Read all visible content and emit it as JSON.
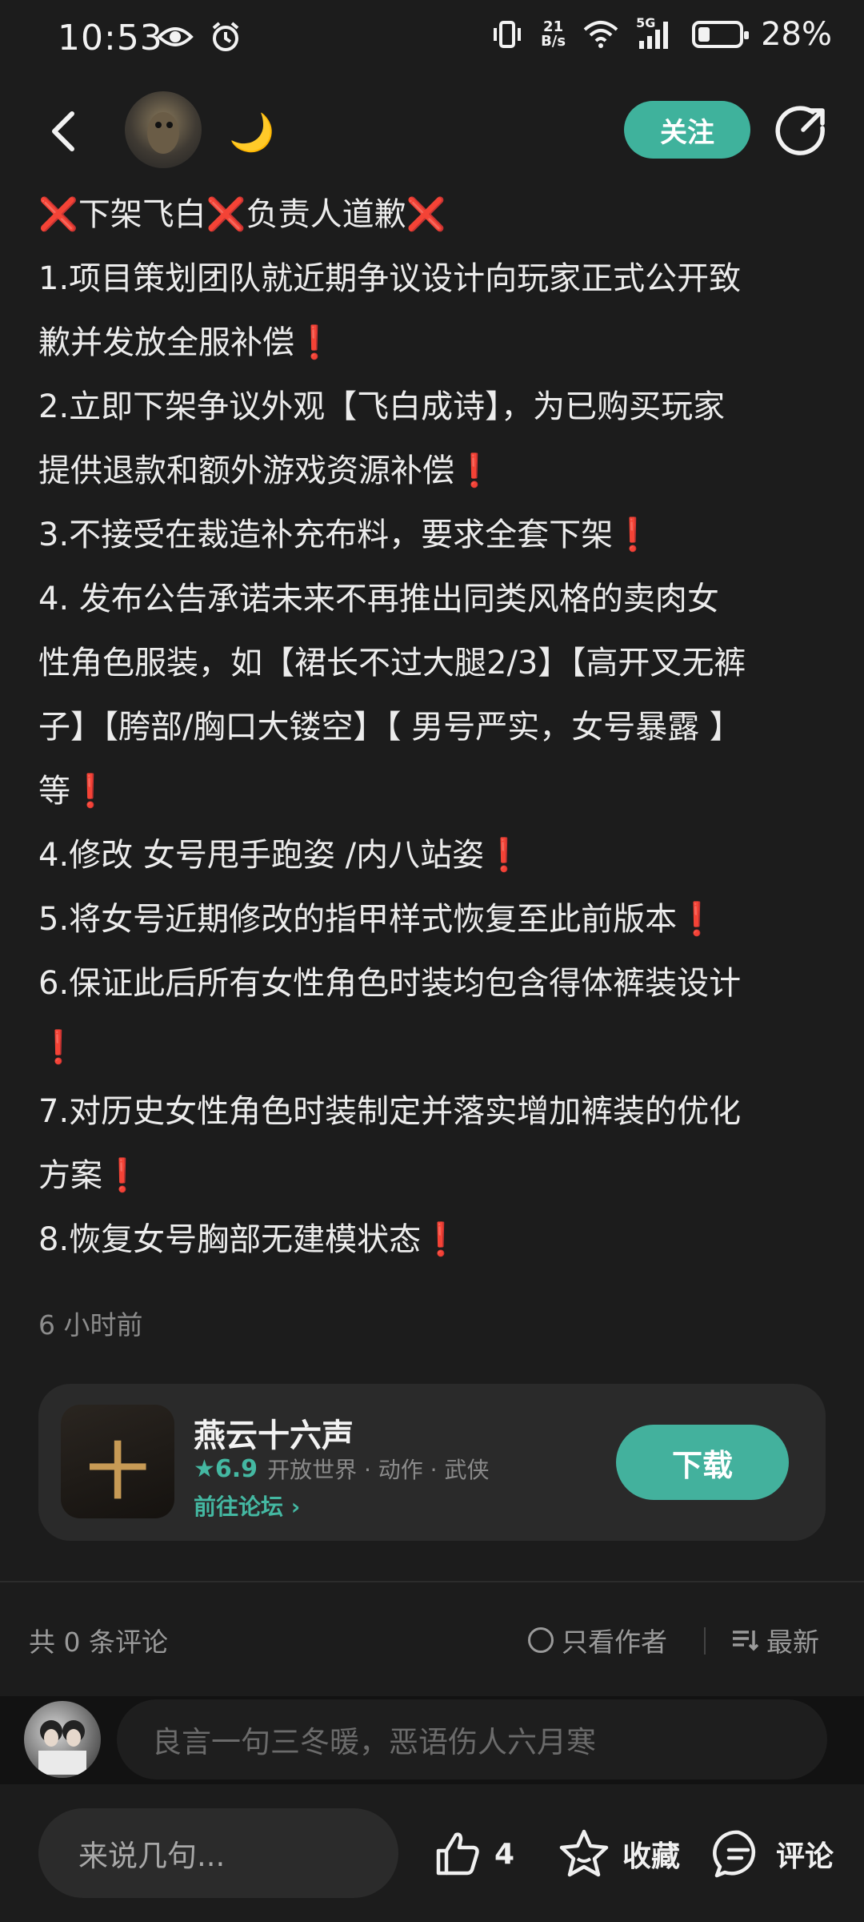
{
  "status_bar": {
    "time": "10:53",
    "net_speed_top": "21",
    "net_speed_bottom": "B/s",
    "signal": "5G",
    "battery": "28%",
    "battery_level": 0.28
  },
  "header": {
    "follow_label": "关注",
    "moon": "🌙"
  },
  "post": {
    "lines": [
      {
        "parts": [
          [
            "x",
            "❌"
          ],
          [
            "t",
            "下架飞白"
          ],
          [
            "x",
            "❌"
          ],
          [
            "t",
            "负责人道歉"
          ],
          [
            "x",
            "❌"
          ]
        ]
      },
      {
        "parts": [
          [
            "t",
            "1.项目策划团队就近期争议设计向玩家正式公开致"
          ]
        ]
      },
      {
        "parts": [
          [
            "t",
            "歉并发放全服补偿"
          ],
          [
            "b",
            "❗"
          ]
        ]
      },
      {
        "parts": [
          [
            "t",
            "2.立即下架争议外观【飞白成诗】，为已购买玩家"
          ]
        ]
      },
      {
        "parts": [
          [
            "t",
            "提供退款和额外游戏资源补偿"
          ],
          [
            "b",
            "❗"
          ]
        ]
      },
      {
        "parts": [
          [
            "t",
            "3.不接受在裁造补充布料，要求全套下架"
          ],
          [
            "b",
            "❗"
          ]
        ]
      },
      {
        "parts": [
          [
            "t",
            "4. 发布公告承诺未来不再推出同类风格的卖肉女"
          ]
        ]
      },
      {
        "parts": [
          [
            "t",
            "性角色服装，如【裙长不过大腿2/3】【高开叉无裤"
          ]
        ]
      },
      {
        "parts": [
          [
            "t",
            "子】【胯部/胸口大镂空】【 男号严实，女号暴露 】"
          ]
        ]
      },
      {
        "parts": [
          [
            "t",
            "等"
          ],
          [
            "b",
            "❗"
          ]
        ]
      },
      {
        "parts": [
          [
            "t",
            "4.修改 女号甩手跑姿 /内八站姿"
          ],
          [
            "b",
            "❗"
          ]
        ]
      },
      {
        "parts": [
          [
            "t",
            "5.将女号近期修改的指甲样式恢复至此前版本"
          ],
          [
            "b",
            "❗"
          ]
        ]
      },
      {
        "parts": [
          [
            "t",
            "6.保证此后所有女性角色时装均包含得体裤装设计"
          ]
        ]
      },
      {
        "parts": [
          [
            "b",
            "❗"
          ]
        ]
      },
      {
        "parts": [
          [
            "t",
            "7.对历史女性角色时装制定并落实增加裤装的优化"
          ]
        ]
      },
      {
        "parts": [
          [
            "t",
            "方案"
          ],
          [
            "b",
            "❗"
          ]
        ]
      },
      {
        "parts": [
          [
            "t",
            "8.恢复女号胸部无建模状态"
          ],
          [
            "b",
            "❗"
          ]
        ]
      }
    ],
    "time_ago": "6 小时前"
  },
  "game_card": {
    "title": "燕云十六声",
    "rating": "6.9",
    "tags": "开放世界 · 动作 · 武侠",
    "forum_link": "前往论坛",
    "download_label": "下载",
    "icon_text": "十卄"
  },
  "comments": {
    "count_label": "共 0 条评论",
    "author_only_label": "只看作者",
    "sort_label": "最新",
    "quote_placeholder": "良言一句三冬暖，恶语伤人六月寒"
  },
  "bottom_bar": {
    "say_placeholder": "来说几句...",
    "like_count": "4",
    "favorite_label": "收藏",
    "comment_label": "评论"
  },
  "colors": {
    "accent": "#43b19d",
    "background": "#1c1c1c",
    "emoji_red": "#e0353b"
  }
}
